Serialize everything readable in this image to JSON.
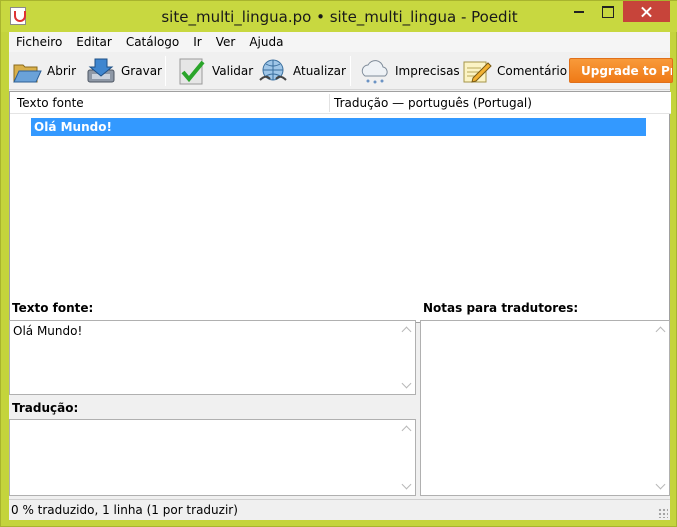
{
  "window": {
    "title": "site_multi_lingua.po • site_multi_lingua - Poedit",
    "app_icon": "poedit-icon"
  },
  "menu": [
    "Ficheiro",
    "Editar",
    "Catálogo",
    "Ir",
    "Ver",
    "Ajuda"
  ],
  "toolbar": {
    "open_label": "Abrir",
    "save_label": "Gravar",
    "validate_label": "Validar",
    "update_label": "Atualizar",
    "fuzzy_label": "Imprecisas",
    "comment_label": "Comentário",
    "upgrade_label": "Upgrade to Pro",
    "upgrade_color": "#f08a24"
  },
  "list": {
    "col_source": "Texto fonte",
    "col_translation": "Tradução — português (Portugal)",
    "rows": [
      {
        "source": "Olá Mundo!",
        "translation": ""
      }
    ],
    "selection_color": "#3399ff"
  },
  "editor": {
    "source_label": "Texto fonte:",
    "source_text": "Olá Mundo!",
    "translation_label": "Tradução:",
    "translation_text": "",
    "notes_label": "Notas para tradutores:"
  },
  "status": {
    "text": "0 % traduzido, 1 linha (1 por traduzir)"
  }
}
